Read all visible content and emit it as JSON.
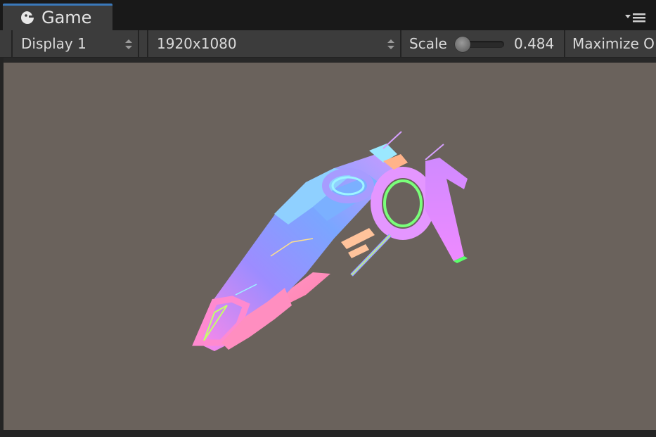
{
  "tab": {
    "label": "Game",
    "icon": "game-controller-icon"
  },
  "toolbar": {
    "display": "Display 1",
    "resolution": "1920x1080",
    "scale_label": "Scale",
    "scale_value": "0.484",
    "maximize": "Maximize O"
  },
  "colors": {
    "accent": "#3a79bb",
    "viewport_bg": "#6a625c",
    "toolbar_bg": "#3c3c3c"
  }
}
